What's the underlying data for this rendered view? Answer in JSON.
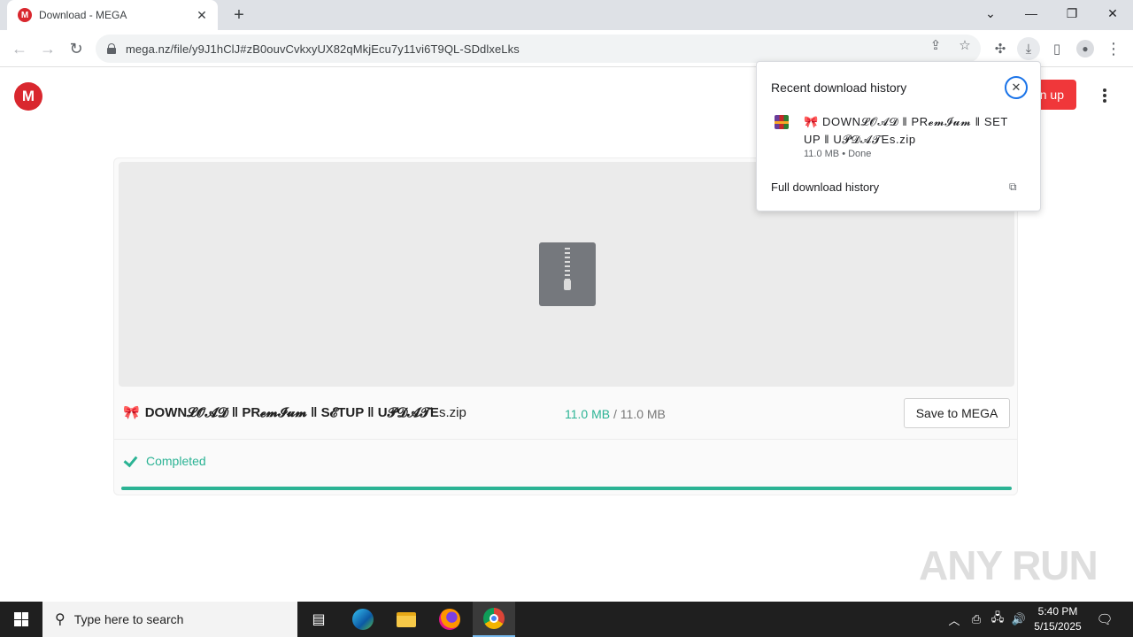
{
  "browser": {
    "tab_title": "Download - MEGA",
    "tab_favicon": "M",
    "url": "mega.nz/file/y9J1hClJ#zB0ouvCvkxyUX82qMkjEcu7y11vi6T9QL-SDdlxeLks"
  },
  "page": {
    "logo": "M",
    "signup_label": "n up",
    "file_icon": "🎀",
    "file_name_styled": "DOWN𝓛𝓞𝓐𝓓 ‖ PR𝓮𝓶𝓘𝓾𝓶 ‖ S𝓔TUP ‖ U𝓟𝓓𝓐𝓣E",
    "file_ext": "s.zip",
    "downloaded_size": "11.0 MB",
    "size_separator": " / ",
    "total_size": "11.0 MB",
    "save_button": "Save to MEGA",
    "status": "Completed",
    "progress": 1.0,
    "accent_color": "#2bb394",
    "brand_color": "#d9272e"
  },
  "download_bubble": {
    "title": "Recent download history",
    "item_name": "🎀 DOWN𝓛𝓞𝓐𝓓 ‖ PR𝓮𝓶𝓘𝓾𝓶 ‖ SET UP ‖ U𝓟𝓓𝓐𝓣Es.zip",
    "item_meta": "11.0 MB • Done",
    "full_history": "Full download history"
  },
  "watermark": "ANY RUN",
  "taskbar": {
    "search_placeholder": "Type here to search",
    "time": "5:40 PM",
    "date": "5/15/2025"
  }
}
